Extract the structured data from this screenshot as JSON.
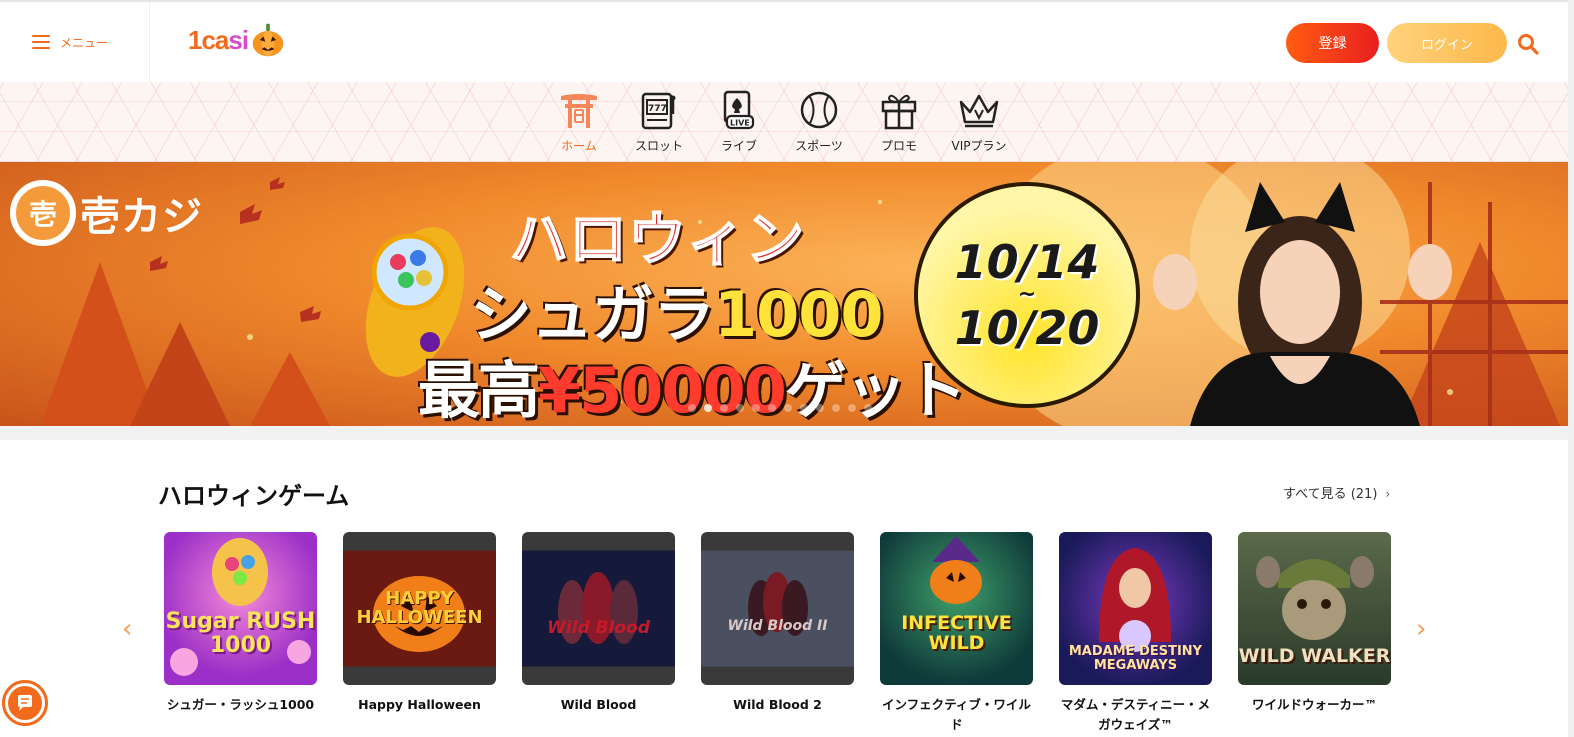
{
  "header": {
    "menu_label": "メニュー",
    "logo_text_a": "1ca",
    "logo_text_b": "si",
    "register_label": "登録",
    "login_label": "ログイン"
  },
  "nav": {
    "items": [
      {
        "label": "ホーム",
        "icon": "torii-home-icon",
        "active": true
      },
      {
        "label": "スロット",
        "icon": "slot-machine-icon",
        "active": false
      },
      {
        "label": "ライブ",
        "icon": "live-cards-icon",
        "active": false
      },
      {
        "label": "スポーツ",
        "icon": "baseball-icon",
        "active": false
      },
      {
        "label": "プロモ",
        "icon": "gift-icon",
        "active": false
      },
      {
        "label": "VIPプラン",
        "icon": "crown-icon",
        "active": false
      }
    ]
  },
  "banner": {
    "brand_mark": "壱",
    "brand_text": "壱カジ",
    "title": "ハロウィン",
    "line1_a": "シュガラ",
    "line1_b": "1000",
    "line2_a": "最高",
    "line2_b": "¥50000",
    "line2_c": "ゲット",
    "date_start": "10/14",
    "date_sep": "~",
    "date_end": "10/20",
    "slide_count": 12,
    "active_slide": 1
  },
  "section": {
    "title": "ハロウィンゲーム",
    "see_all": "すべて見る (21)"
  },
  "games": [
    {
      "name": "シュガー・ラッシュ1000",
      "thumb_text": "Sugar RUSH 1000"
    },
    {
      "name": "Happy Halloween",
      "thumb_text": "HAPPY HALLOWEEN"
    },
    {
      "name": "Wild Blood",
      "thumb_text": "Wild Blood"
    },
    {
      "name": "Wild Blood 2",
      "thumb_text": "Wild Blood II"
    },
    {
      "name": "インフェクティブ・ワイルド",
      "thumb_text": "INFECTIVE WILD"
    },
    {
      "name": "マダム・デスティニー・メガウェイズ™",
      "thumb_text": "MADAME DESTINY MEGAWAYS"
    },
    {
      "name": "ワイルドウォーカー™",
      "thumb_text": "WILD WALKER"
    }
  ],
  "colors": {
    "accent": "#f26b1d",
    "register_gradient": [
      "#ff5c12",
      "#e91f1f"
    ],
    "login_gradient": [
      "#ffd27a",
      "#fcb84c"
    ]
  }
}
